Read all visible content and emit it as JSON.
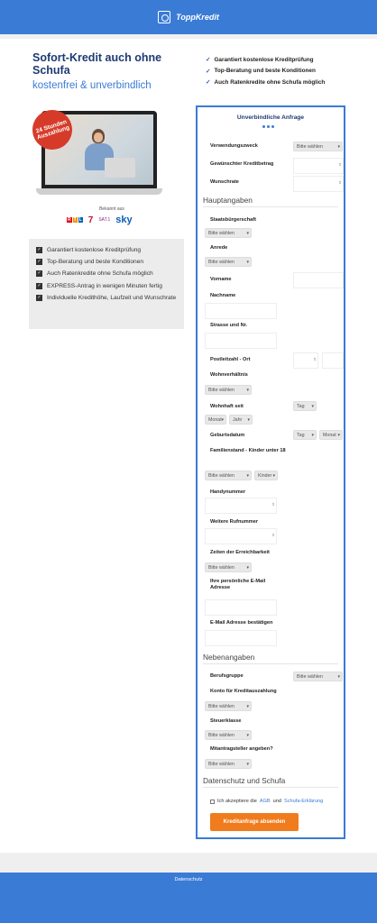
{
  "brand": {
    "name": "ToppKredit"
  },
  "hero": {
    "title": "Sofort-Kredit auch ohne Schufa",
    "subtitle": "kostenfrei & unverbindlich",
    "badge": "24 Stunden Auszahlung"
  },
  "promo_points": [
    "Garantiert kostenlose Kreditprüfung",
    "Top-Beratung und beste Konditionen",
    "Auch Ratenkredite ohne Schufa möglich"
  ],
  "known_from": {
    "label": "Bekannt aus",
    "brands": [
      "RTL",
      "7",
      "SAT.1",
      "sky"
    ]
  },
  "benefits": [
    "Garantiert kostenlose Kreditprüfung",
    "Top-Beratung und beste Konditionen",
    "Auch Ratenkredite ohne Schufa möglich",
    "EXPRESS-Antrag in wenigen Minuten fertig",
    "Individuelle Kredithöhe, Laufzeit und Wunschrate"
  ],
  "form": {
    "title": "Unverbindliche Anfrage",
    "labels": {
      "verwendungszweck": "Verwendungszweck",
      "kreditbetrag": "Gewünschter Kreditbetrag",
      "wunschrate": "Wunschrate",
      "staatsbuergerschaft": "Staatsbürgerschaft",
      "anrede": "Anrede",
      "vorname": "Vorname",
      "nachname": "Nachname",
      "strasse": "Strasse und Nr.",
      "plz_ort": "Postleitzahl - Ort",
      "wohnverhaeltnis": "Wohnverhältnis",
      "wohnhaft_seit": "Wohnhaft seit",
      "geburtsdatum": "Geburtsdatum",
      "familienstand": "Familienstand - Kinder unter 18",
      "handynummer": "Handynummer",
      "weitere_rufnummer": "Weitere Rufnummer",
      "erreichbarkeit": "Zeiten der Erreichbarkeit",
      "email": "Ihre persönliche E-Mail Adresse",
      "email_confirm": "E-Mail Adresse bestätigen",
      "berufsgruppe": "Berufsgruppe",
      "konto": "Konto für Kreditauszahlung",
      "steuerklasse": "Steuerklasse",
      "mitantragsteller": "Mitantragsteller angeben?"
    },
    "sections": {
      "hauptangaben": "Hauptangaben",
      "nebenangaben": "Nebenangaben",
      "datenschutz": "Datenschutz und Schufa"
    },
    "select_default": "Bitte wählen",
    "tag": "Tag",
    "monat": "Monat",
    "jahr": "Jahr",
    "kinder": "Kinder",
    "consent_prefix": "Ich akzeptiere die",
    "consent_agb": "AGB",
    "consent_und": "und",
    "consent_schufa": "Schufa-Erklärung",
    "submit": "Kreditanfrage absenden"
  },
  "footer": {
    "link": "Datenschutz"
  },
  "colors": {
    "primary": "#3a7bd5",
    "accent": "#f07c1e",
    "badge": "#d63b2a",
    "title": "#1f3a73"
  }
}
